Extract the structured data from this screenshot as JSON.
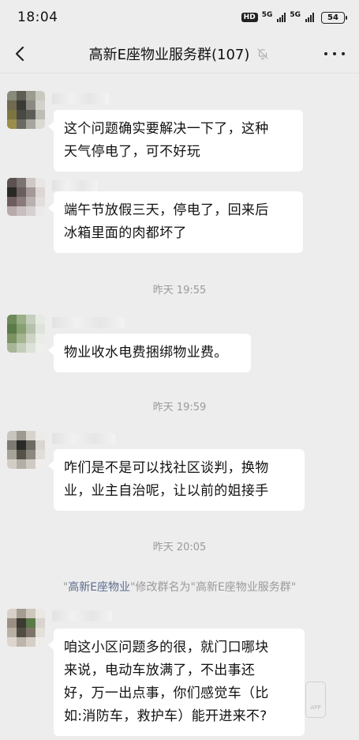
{
  "status_bar": {
    "time": "18:04",
    "hd": "HD",
    "net1": "5G",
    "net2": "5G",
    "battery": "54"
  },
  "header": {
    "title": "高新E座物业服务群(107)",
    "back_icon": "chevron-left-icon",
    "mute_icon": "bell-off-icon",
    "more_icon": "more-horizontal-icon"
  },
  "messages": [
    {
      "text": "这个问题确实要解决一下了，这种\n天气停电了，可不好玩"
    },
    {
      "text": "端午节放假三天，停电了，回来后\n冰箱里面的肉都坏了"
    },
    {
      "text": "物业收水电费捆绑物业费。"
    },
    {
      "text": "咋们是不是可以找社区谈判，换物\n业，业主自治呢，让以前的姐接手"
    },
    {
      "text": "咱这小区问题多的很，就门口哪块\n来说，电动车放满了，不出事还\n好，万一出点事，你们感觉车（比\n如:消防车，救护车）能开进来不?"
    }
  ],
  "timestamps": [
    "昨天 19:55",
    "昨天 19:59",
    "昨天 20:05"
  ],
  "system_message": {
    "open_quote": "\"",
    "actor": "高新E座物业",
    "action": "\"修改群名为\"高新E座物业服务群\""
  },
  "watermark": "APP",
  "colors": {
    "background": "#ededed",
    "bubble": "#ffffff",
    "system_link": "#5b6b8c",
    "muted_text": "#9a9a9a"
  }
}
